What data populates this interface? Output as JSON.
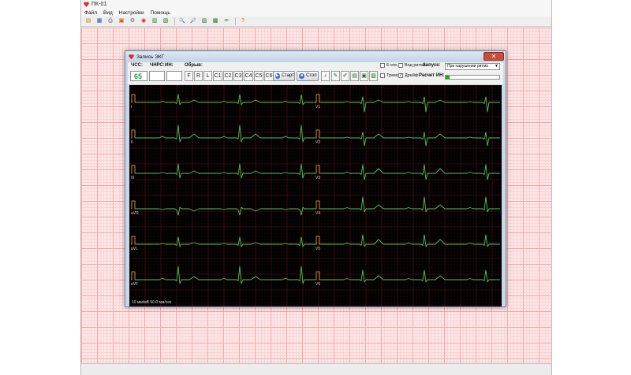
{
  "app": {
    "title": "ПК-01"
  },
  "menu": [
    {
      "label": "Файл"
    },
    {
      "label": "Вид"
    },
    {
      "label": "Настройки"
    },
    {
      "label": "Помощь"
    }
  ],
  "toolbar": {
    "icons": [
      {
        "name": "open-icon",
        "glyph": "▤"
      },
      {
        "name": "save-icon",
        "glyph": "▦"
      },
      {
        "name": "print-icon",
        "glyph": "⎙"
      },
      {
        "name": "export-icon",
        "glyph": "▣"
      },
      {
        "name": "settings-icon",
        "glyph": "⚙"
      },
      {
        "name": "record-icon",
        "glyph": "◉"
      },
      {
        "name": "database-icon",
        "glyph": "▥"
      },
      {
        "name": "analysis-icon",
        "glyph": "▧"
      },
      {
        "name": "zoom-in-icon",
        "glyph": "🔍"
      },
      {
        "name": "zoom-out-icon",
        "glyph": "🔎"
      },
      {
        "name": "report-icon",
        "glyph": "▨"
      },
      {
        "name": "monitor-icon",
        "glyph": "▩"
      },
      {
        "name": "signal-icon",
        "glyph": "♒"
      },
      {
        "name": "help-icon",
        "glyph": "?"
      }
    ]
  },
  "dialog": {
    "title": "Запись ЭКГ",
    "close_glyph": "✕",
    "hr_label": "ЧСС:",
    "hr_value": "65",
    "pvc_label": "ЧНРС:",
    "hm_label": "ИН:",
    "filter_label": "Обрыв:",
    "filter_leads": [
      "F",
      "R",
      "L",
      "C1",
      "C2",
      "C3",
      "C4",
      "C5",
      "C6"
    ],
    "start_label": "Старт",
    "stop_label": "Стоп",
    "checkboxes": [
      {
        "label": "6 отв.",
        "checked": false
      },
      {
        "label": "Вод ритма",
        "checked": false
      },
      {
        "label": "Тремор",
        "checked": false
      },
      {
        "label": "Дрейф",
        "checked": true
      }
    ],
    "trigger_label": "Запуск:",
    "trigger_value": "При нарушении ритма",
    "rhythm_label": "Расчет ИН:",
    "rhythm_progress": 0.08,
    "leads_left": [
      "I",
      "II",
      "III",
      "aVR",
      "aVL",
      "aVF"
    ],
    "leads_right": [
      "V1",
      "V2",
      "V3",
      "V4",
      "V5",
      "V6"
    ],
    "status_text": "10 мм/мВ 50.0 мм/сек",
    "colors": {
      "trace": "#58c24f",
      "grid_major": "#5a1a1a",
      "grid_minor": "#2b0d0d",
      "pulse": "#e5b43a"
    }
  }
}
